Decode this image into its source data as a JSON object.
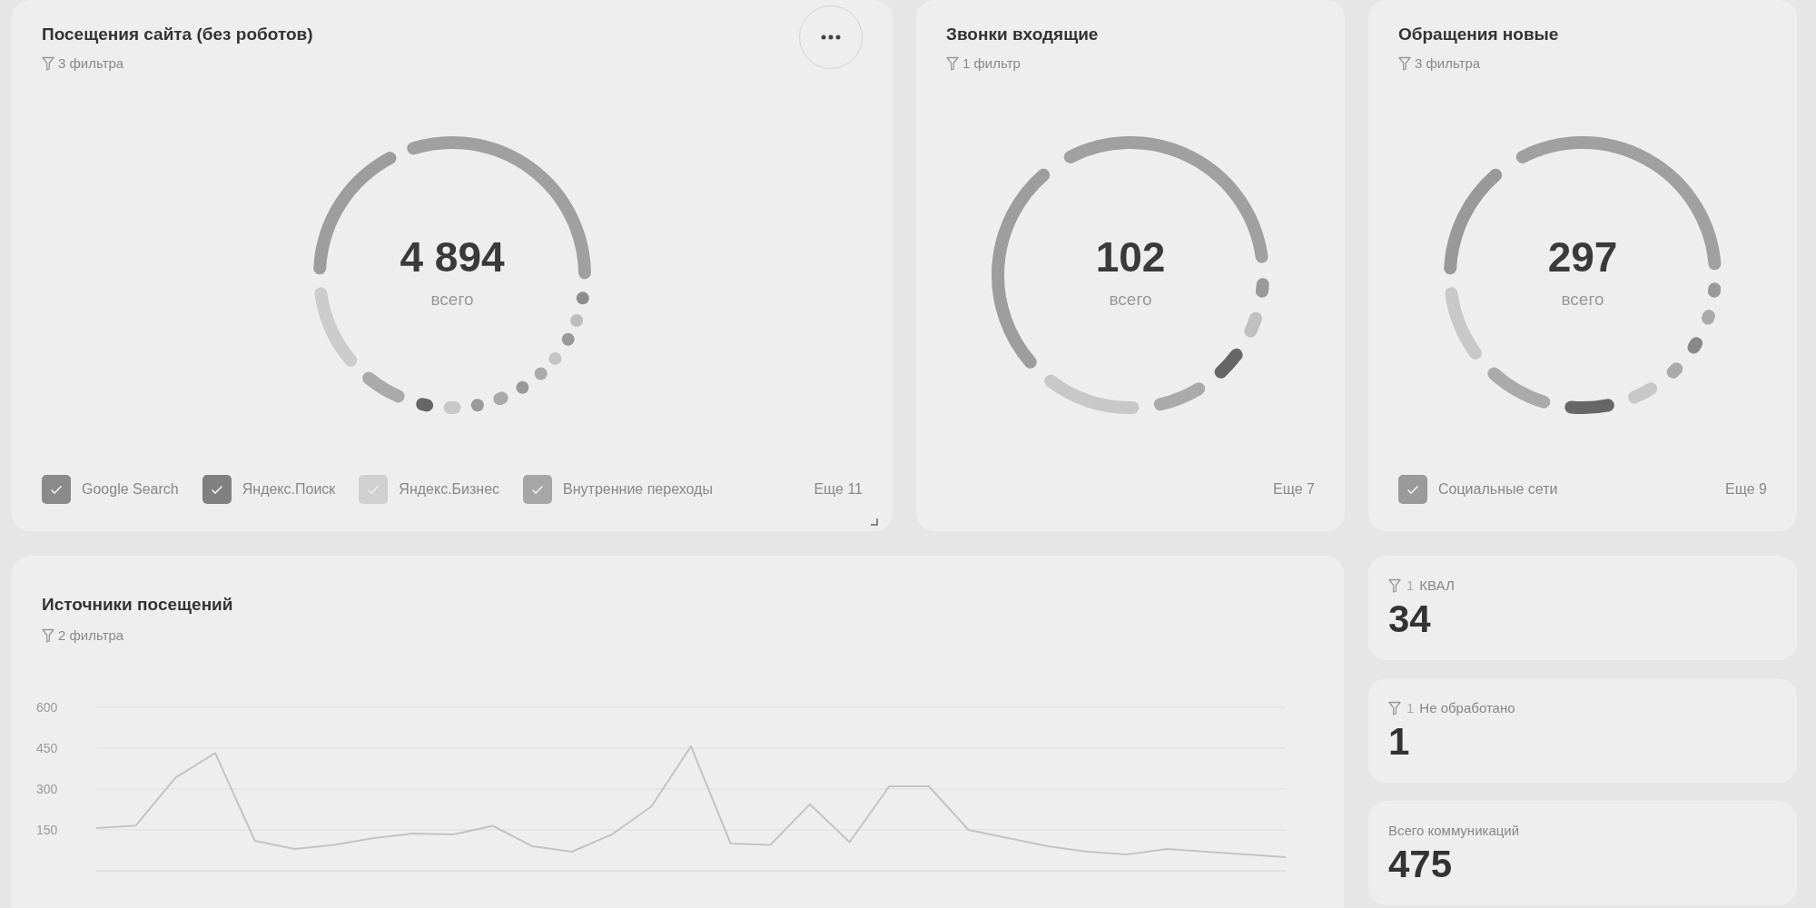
{
  "donut_cards": [
    {
      "title": "Посещения сайта (без роботов)",
      "filter": "3 фильтра",
      "total": "4 894",
      "total_label": "всего",
      "menu": true,
      "resize_handle": true,
      "more": "Еще 11",
      "legend": [
        {
          "label": "Google Search",
          "checked": true,
          "color": "#8a8a8a"
        },
        {
          "label": "Яндекс.Поиск",
          "checked": true,
          "color": "#808080"
        },
        {
          "label": "Яндекс.Бизнес",
          "checked": true,
          "color": "#d0d0d0"
        },
        {
          "label": "Внутренние переходы",
          "checked": true,
          "color": "#a6a6a6"
        }
      ]
    },
    {
      "title": "Звонки входящие",
      "filter": "1 фильтр",
      "total": "102",
      "total_label": "всего",
      "menu": false,
      "resize_handle": false,
      "more": "Еще 7"
    },
    {
      "title": "Обращения новые",
      "filter": "3 фильтра",
      "total": "297",
      "total_label": "всего",
      "menu": false,
      "resize_handle": false,
      "more": "Еще 9",
      "legend": [
        {
          "label": "Социальные сети",
          "checked": true,
          "color": "#9a9a9a"
        }
      ]
    }
  ],
  "chart_card": {
    "title": "Источники посещений",
    "filter": "2 фильтра",
    "chart_data": {
      "type": "line",
      "grid": true,
      "ylim": [
        0,
        600
      ],
      "yticks": [
        150,
        300,
        450,
        600
      ],
      "series": [
        {
          "color": "#c4c4c4",
          "values": [
            157,
            166,
            342,
            432,
            110,
            80,
            95,
            120,
            137,
            133,
            165,
            90,
            70,
            133,
            236,
            457,
            100,
            95,
            244,
            105,
            310,
            310,
            150,
            120,
            90,
            70,
            60,
            80,
            70,
            60,
            50
          ]
        }
      ]
    }
  },
  "stat_cards": [
    {
      "kind": "filtered",
      "filter_count": "1",
      "label": "КВАЛ",
      "value": "34"
    },
    {
      "kind": "filtered",
      "filter_count": "1",
      "label": "Не обработано",
      "value": "1"
    },
    {
      "kind": "plain",
      "label": "Всего коммуникаций",
      "value": "475"
    }
  ]
}
